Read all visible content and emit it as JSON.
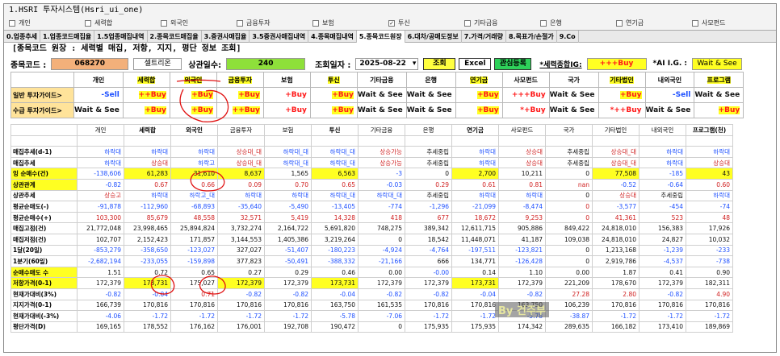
{
  "window": {
    "title": "1.HSRI 투자시스템(Hsri_ui_one)"
  },
  "checkboxes": [
    {
      "label": "개인",
      "checked": false
    },
    {
      "label": "세력합",
      "checked": false
    },
    {
      "label": "외국인",
      "checked": false
    },
    {
      "label": "금융투자",
      "checked": false
    },
    {
      "label": "보험",
      "checked": false
    },
    {
      "label": "투신",
      "checked": true
    },
    {
      "label": "기타금융",
      "checked": false
    },
    {
      "label": "은행",
      "checked": false
    },
    {
      "label": "연기금",
      "checked": false
    },
    {
      "label": "사모펀드",
      "checked": false
    }
  ],
  "tabs": [
    "0.업종추세",
    "1.업종코드매집율",
    "1.5업종매집내역",
    "2.종목코드매집율",
    "3.증권사매집율",
    "3.5증권사매집내역",
    "4.종목매집내역",
    "5.종목코드원장",
    "6.대차/공매도정보",
    "7.가격/거래량",
    "8.목표가/손절가",
    "9.Co"
  ],
  "active_tab": 7,
  "panel_title": "[종목코드 원장 : 세력별 매집, 저항, 지지, 평단 정보 조회]",
  "controls": {
    "code_label": "종목코드 :",
    "code_value": "068270",
    "name_value": "셀트리온",
    "listed_label": "상관일수:",
    "listed_value": "240",
    "date_label": "조회일자 :",
    "date_value": "2025-08-22",
    "date_arrow": "▾",
    "query_button": "조회",
    "excel_button": "Excel",
    "interest_button": "관심등록",
    "force_label": "*세력종합IG:",
    "force_value": "+++Buy",
    "ai_label": "*AI I.G. :",
    "ai_value": "Wait & See"
  },
  "guide": {
    "headers": [
      "개인",
      "세력합",
      "외국인",
      "금융투자",
      "보험",
      "투신",
      "기타금융",
      "은행",
      "연기금",
      "사모펀드",
      "국가",
      "기타법인",
      "내외국인",
      "프로그램"
    ],
    "rows": [
      {
        "label": "일반 투자가이드>",
        "cells": [
          "-Sell",
          "++Buy",
          "+Buy",
          "+Buy",
          "+Buy",
          "+Buy",
          "Wait & See",
          "Wait & See",
          "+Buy",
          "+++Buy",
          "Wait & See",
          "+Buy",
          "-Sell",
          "Wait & See"
        ]
      },
      {
        "label": "수급 투자가이드>",
        "cells": [
          "Wait & See",
          "+Buy",
          "+Buy",
          "++Buy",
          "+Buy",
          "+Buy",
          "Wait & See",
          "Wait & See",
          "+Buy",
          "*+Buy",
          "Wait & See",
          "*++Buy",
          "Wait & See",
          "+Buy"
        ]
      }
    ]
  },
  "grid": {
    "headers": [
      "",
      "개인",
      "세력합",
      "외국인",
      "금융투자",
      "보험",
      "투신",
      "기타금융",
      "은행",
      "연기금",
      "사모펀드",
      "국가",
      "기타법인",
      "내외국인",
      "프로그램(천)"
    ],
    "rows": [
      {
        "label": "",
        "cells": [
          "",
          "",
          "",
          "",
          "",
          "",
          "",
          "",
          "",
          "",
          "",
          "",
          "",
          ""
        ]
      },
      {
        "label": "매집추세(d-1)",
        "cells": [
          "하락대",
          "하락대",
          "하락대",
          "상승대_대",
          "하락대_대",
          "하락대_대",
          "상승가능",
          "추세중립",
          "하락대",
          "상승대",
          "추세중립",
          "상승대_대",
          "하락대",
          "하락대"
        ]
      },
      {
        "label": "매집추세",
        "cells": [
          "하락대",
          "상승대",
          "하락고",
          "상승대_대",
          "하락대_대",
          "하락대_대",
          "상승가능",
          "추세중립",
          "하락대",
          "상승대",
          "추세중립",
          "상승대_대",
          "하락대",
          "상승대"
        ]
      },
      {
        "label": "잉 순매수(건)",
        "cells": [
          "-138,606",
          "61,283",
          "31,610",
          "8,637",
          "1,565",
          "6,563",
          "-3",
          "0",
          "2,700",
          "10,211",
          "0",
          "77,508",
          "-185",
          "43"
        ]
      },
      {
        "label": "상관관계",
        "cells": [
          "-0.82",
          "0.67",
          "0.66",
          "0.09",
          "0.70",
          "0.65",
          "-0.03",
          "0.29",
          "0.61",
          "0.81",
          "nan",
          "-0.52",
          "-0.64",
          "0.60"
        ]
      },
      {
        "label": "상관추세",
        "cells": [
          "상승고",
          "하락대",
          "하락고_대",
          "하락대",
          "하락대",
          "하락대_대",
          "하락대_대",
          "추세중립",
          "하락대",
          "하락대",
          "0",
          "상승대",
          "추세중립",
          "하락대"
        ]
      },
      {
        "label": "평균순매도(-)",
        "cells": [
          "-91,878",
          "-112,960",
          "-68,893",
          "-35,640",
          "-5,490",
          "-13,405",
          "-774",
          "-1,296",
          "-21,099",
          "-8,474",
          "0",
          "-3,577",
          "-454",
          "-74"
        ]
      },
      {
        "label": "평균순매수(+)",
        "cells": [
          "103,300",
          "85,679",
          "48,558",
          "32,571",
          "5,419",
          "14,328",
          "418",
          "677",
          "18,672",
          "9,253",
          "0",
          "41,361",
          "523",
          "48"
        ]
      },
      {
        "label": "매집고점(건)",
        "cells": [
          "21,772,048",
          "23,998,465",
          "25,894,824",
          "3,732,274",
          "2,164,722",
          "5,691,820",
          "748,275",
          "389,342",
          "12,611,715",
          "905,886",
          "849,422",
          "24,818,010",
          "156,383",
          "17,926"
        ]
      },
      {
        "label": "매집저점(건)",
        "cells": [
          "102,707",
          "2,152,423",
          "171,857",
          "3,144,553",
          "1,405,386",
          "3,219,264",
          "0",
          "18,542",
          "11,448,071",
          "41,187",
          "109,038",
          "24,818,010",
          "24,827",
          "10,032"
        ]
      },
      {
        "label": "1달(20일)",
        "cells": [
          "-853,279",
          "-358,650",
          "-123,027",
          "327,027",
          "-51,407",
          "-180,223",
          "-4,924",
          "-4,764",
          "-197,511",
          "-123,821",
          "0",
          "1,213,168",
          "-1,239",
          "-233"
        ]
      },
      {
        "label": "1분기(60일)",
        "cells": [
          "-2,682,194",
          "-233,055",
          "-159,898",
          "377,823",
          "-50,491",
          "-388,332",
          "-21,166",
          "666",
          "134,771",
          "-126,428",
          "0",
          "2,919,786",
          "-4,537",
          "-738"
        ]
      },
      {
        "label": "순매수매도 수",
        "cells": [
          "1.51",
          "0.72",
          "0.65",
          "0.27",
          "0.29",
          "0.46",
          "0.00",
          "-0.00",
          "0.14",
          "1.10",
          "0.00",
          "1.87",
          "0.41",
          "0.90"
        ]
      },
      {
        "label": "저항가격(0-1)",
        "cells": [
          "172,379",
          "173,731",
          "175,027",
          "172,379",
          "172,379",
          "173,731",
          "172,379",
          "172,379",
          "173,731",
          "172,379",
          "221,209",
          "178,670",
          "172,379",
          "182,311"
        ]
      },
      {
        "label": "현재가대비(3%)",
        "cells": [
          "-0.82",
          "-0.04",
          "0.71",
          "-0.82",
          "-0.82",
          "-0.04",
          "-0.82",
          "-0.82",
          "-0.04",
          "-0.82",
          "27.28",
          "2.80",
          "-0.82",
          "4.90"
        ]
      },
      {
        "label": "지지가격(0-1)",
        "cells": [
          "166,739",
          "170,816",
          "170,816",
          "170,816",
          "170,816",
          "163,750",
          "161,535",
          "170,816",
          "170,816",
          "163,750",
          "106,239",
          "170,816",
          "170,816",
          "170,816"
        ]
      },
      {
        "label": "현재가대비(-3%)",
        "cells": [
          "-4.06",
          "-1.72",
          "-1.72",
          "-1.72",
          "-1.72",
          "-5.78",
          "-7.06",
          "-1.72",
          "-1.72",
          "-5.78",
          "-38.87",
          "-1.72",
          "-1.72",
          "-1.72"
        ]
      },
      {
        "label": "평단가격(D)",
        "cells": [
          "169,165",
          "178,552",
          "176,162",
          "176,001",
          "192,708",
          "190,472",
          "0",
          "175,935",
          "175,935",
          "174,342",
          "289,635",
          "166,182",
          "173,410",
          "189,869"
        ]
      }
    ]
  },
  "watermark": "By 건주부",
  "colors": {
    "highlight": "#ffff22",
    "blue": "#1e50ff",
    "red": "#ff1818",
    "code": "#f3b07a",
    "listed": "#8ee03a",
    "query": "#ffff40",
    "interest": "#2ed15a",
    "annotation": "#e01010"
  }
}
